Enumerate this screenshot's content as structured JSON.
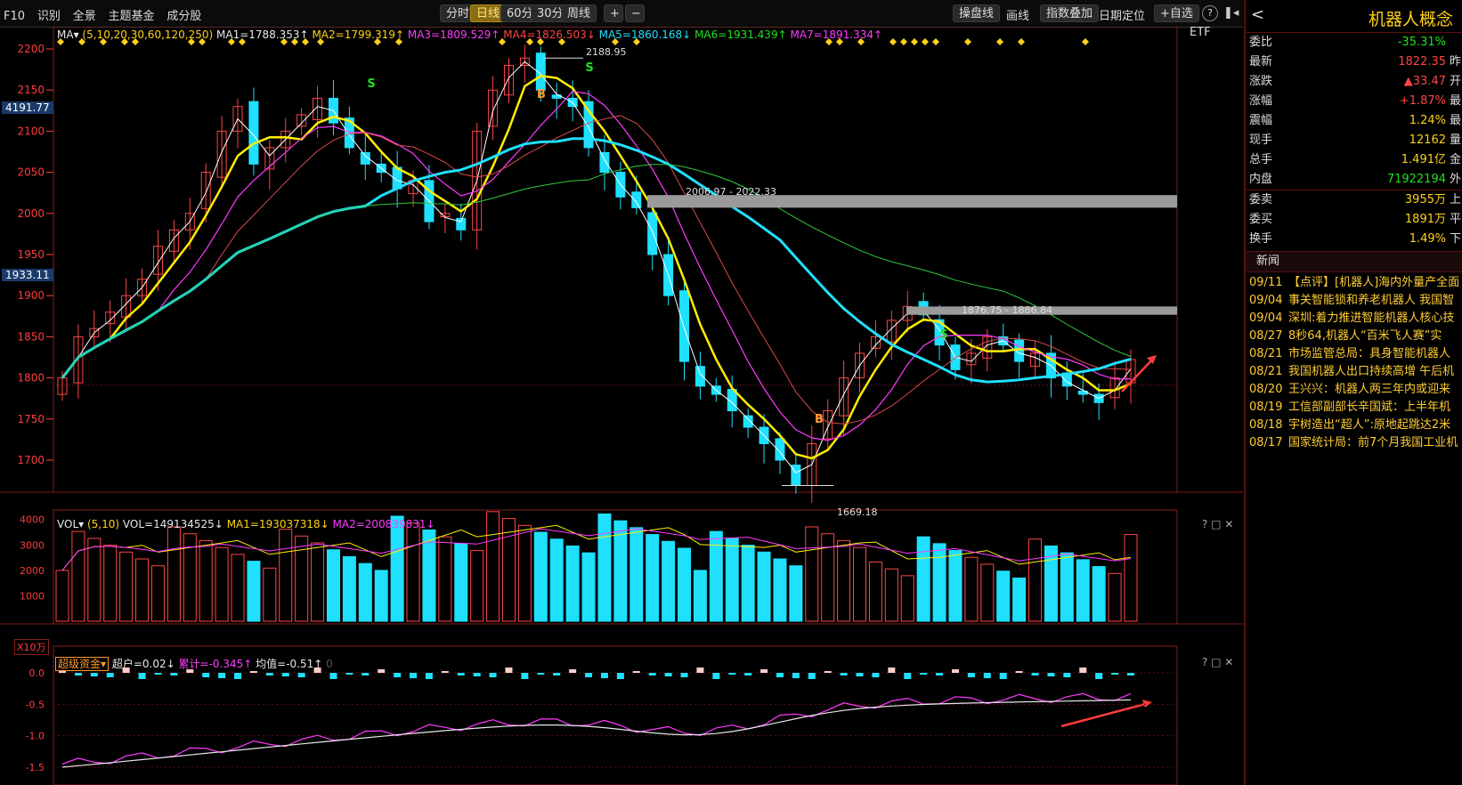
{
  "toolbar": {
    "left_items": [
      "F10",
      "识别",
      "全景",
      "主题基金",
      "成分股"
    ],
    "periods": [
      "分时",
      "日线",
      "60分",
      "30分",
      "周线"
    ],
    "active_period": "日线",
    "zoom_in": "+",
    "zoom_out": "−",
    "right_items": {
      "pan": "操盘线",
      "draw": "画线",
      "overlay": "指数叠加",
      "date": "日期定位",
      "fav": "+自选",
      "help": "?"
    }
  },
  "main_chart": {
    "ma_legend": {
      "head": "MA▾",
      "params": "(5,10,20,30,60,120,250)",
      "ma1": "MA1=1788.353↑",
      "ma2": "MA2=1799.319↑",
      "ma3": "MA3=1809.529↑",
      "ma4": "MA4=1826.503↓",
      "ma5": "MA5=1860.168↓",
      "ma6": "MA6=1931.439↑",
      "ma7": "MA7=1891.334↑"
    },
    "etf_label": "ETF",
    "y_ticks": [
      "2200",
      "2150",
      "2100",
      "2050",
      "2000",
      "1950",
      "1900",
      "1850",
      "1800",
      "1750",
      "1700"
    ],
    "price_tag_top": "4191.77",
    "price_tag_ma": "1933.11",
    "annotations": {
      "high": "2188.95",
      "low": "1669.18",
      "gap1": "2006.97 - 2022.33",
      "gap2": "1876.75 - 1886.84",
      "s_mark": "S",
      "b_mark": "B"
    }
  },
  "vol_chart": {
    "legend": {
      "head": "VOL▾",
      "params": "(5,10)",
      "vol": "VOL=149134525↓",
      "ma1": "MA1=193037318↓",
      "ma2": "MA2=200839831↓"
    },
    "y_ticks": [
      "4000",
      "3000",
      "2000",
      "1000"
    ],
    "unit": "X10万"
  },
  "fund_chart": {
    "legend": {
      "head": "超级资金▾",
      "super": "超户=0.02↓",
      "cum": "累计=-0.345↑",
      "avg": "均值=-0.51↑",
      "extra": "0"
    },
    "y_ticks": [
      "0.0",
      "-0.5",
      "-1.0",
      "-1.5"
    ]
  },
  "panel_controls": "? □ ✕",
  "side": {
    "back": "<",
    "title": "机器人概念",
    "quotes": [
      {
        "label": "委比",
        "value": "-35.31%",
        "tail": "",
        "color": "green"
      },
      {
        "label": "最新",
        "value": "1822.35",
        "tail": "昨",
        "color": "red"
      },
      {
        "label": "涨跌",
        "value": "▲33.47",
        "tail": "开",
        "color": "red"
      },
      {
        "label": "涨幅",
        "value": "+1.87%",
        "tail": "最",
        "color": "red"
      },
      {
        "label": "震幅",
        "value": "1.24%",
        "tail": "最",
        "color": "yellow"
      },
      {
        "label": "现手",
        "value": "12162",
        "tail": "量",
        "color": "yellow"
      },
      {
        "label": "总手",
        "value": "1.491亿",
        "tail": "金",
        "color": "yellow"
      },
      {
        "label": "内盘",
        "value": "71922194",
        "tail": "外",
        "color": "green"
      },
      {
        "label": "委卖",
        "value": "3955万",
        "tail": "上",
        "color": "yellow"
      },
      {
        "label": "委买",
        "value": "1891万",
        "tail": "平",
        "color": "yellow"
      },
      {
        "label": "换手",
        "value": "1.49%",
        "tail": "下",
        "color": "yellow"
      }
    ],
    "news_header": "新闻",
    "news": [
      {
        "date": "09/11",
        "text": "【点评】[机器人]海内外量产全面"
      },
      {
        "date": "09/04",
        "text": "事关智能锁和养老机器人 我国智"
      },
      {
        "date": "09/04",
        "text": "深圳:着力推进智能机器人核心技"
      },
      {
        "date": "08/27",
        "text": "8秒64,机器人“百米飞人赛”实"
      },
      {
        "date": "08/21",
        "text": "市场监管总局：具身智能机器人"
      },
      {
        "date": "08/21",
        "text": "我国机器人出口持续高增 午后机"
      },
      {
        "date": "08/20",
        "text": "王兴兴：机器人两三年内或迎来"
      },
      {
        "date": "08/19",
        "text": "工信部副部长辛国斌：上半年机"
      },
      {
        "date": "08/18",
        "text": "宇树造出“超人”:原地起跳达2米"
      },
      {
        "date": "08/17",
        "text": "国家统计局：前7个月我国工业机"
      }
    ]
  },
  "colors": {
    "up": "#ff4545",
    "down": "#1fe0ff",
    "ma1": "#ffffff",
    "ma2": "#ffee00",
    "ma3": "#ff3bff",
    "ma5": "#1fe0ff",
    "ma6": "#2ecc40",
    "frame": "#8a1b1b"
  },
  "chart_data": {
    "type": "candlestick",
    "y_range_main": [
      1669.18,
      2188.95
    ],
    "ohlc_closes_approx": [
      1800,
      1850,
      1860,
      1880,
      1900,
      1920,
      1960,
      1980,
      2000,
      2050,
      2100,
      2130,
      2060,
      2080,
      2100,
      2120,
      2140,
      2110,
      2080,
      2060,
      2050,
      2030,
      2040,
      1990,
      2000,
      1980,
      2100,
      2150,
      2180,
      2188.95,
      2150,
      2140,
      2130,
      2080,
      2050,
      2020,
      2006.97,
      1950,
      1900,
      1820,
      1790,
      1780,
      1760,
      1740,
      1720,
      1700,
      1669.18,
      1720,
      1760,
      1800,
      1830,
      1850,
      1870,
      1886.84,
      1876.75,
      1840,
      1810,
      1830,
      1850,
      1840,
      1820,
      1830,
      1800,
      1790,
      1780,
      1770,
      1800,
      1822.35
    ]
  }
}
